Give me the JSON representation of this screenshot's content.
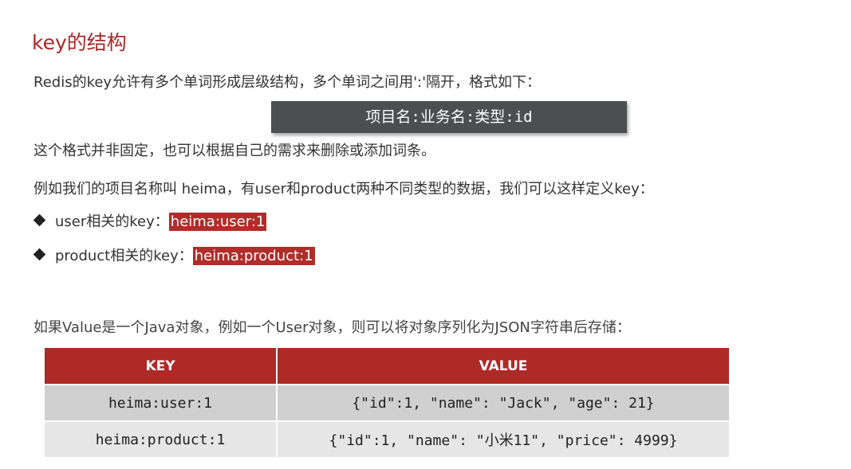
{
  "title": "key的结构",
  "intro": "Redis的key允许有多个单词形成层级结构，多个单词之间用':'隔开，格式如下：",
  "format": "项目名:业务名:类型:id",
  "note": "这个格式并非固定，也可以根据自己的需求来删除或添加词条。",
  "example": "例如我们的项目名称叫 heima，有user和product两种不同类型的数据，我们可以这样定义key：",
  "bullets": [
    {
      "label": "user相关的key：",
      "key": "heima:user:1"
    },
    {
      "label": "product相关的key：",
      "key": "heima:product:1"
    }
  ],
  "json_note": "如果Value是一个Java对象，例如一个User对象，则可以将对象序列化为JSON字符串后存储：",
  "table": {
    "headers": [
      "KEY",
      "VALUE"
    ],
    "rows": [
      [
        "heima:user:1",
        "{\"id\":1, \"name\": \"Jack\", \"age\": 21}"
      ],
      [
        "heima:product:1",
        "{\"id\":1, \"name\": \"小米11\", \"price\": 4999}"
      ]
    ]
  },
  "colors": {
    "accent": "#ad2a27",
    "format_box": "#4b4f4f"
  }
}
